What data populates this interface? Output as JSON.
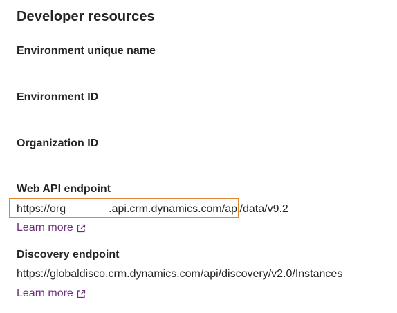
{
  "panel": {
    "title": "Developer resources",
    "sections": [
      {
        "label": "Environment unique name"
      },
      {
        "label": "Environment ID"
      },
      {
        "label": "Organization ID"
      },
      {
        "label": "Web API endpoint",
        "value_prefix": "https://org",
        "value_suffix": ".api.crm.dynamics.com/api/data/v9.2",
        "link": "Learn more"
      },
      {
        "label": "Discovery endpoint",
        "value": "https://globaldisco.crm.dynamics.com/api/discovery/v2.0/Instances",
        "link": "Learn more"
      }
    ]
  },
  "icons": {
    "external_link": "external-link-icon"
  },
  "colors": {
    "link": "#6b2f7a",
    "highlight": "#e0872f",
    "text": "#242424"
  }
}
